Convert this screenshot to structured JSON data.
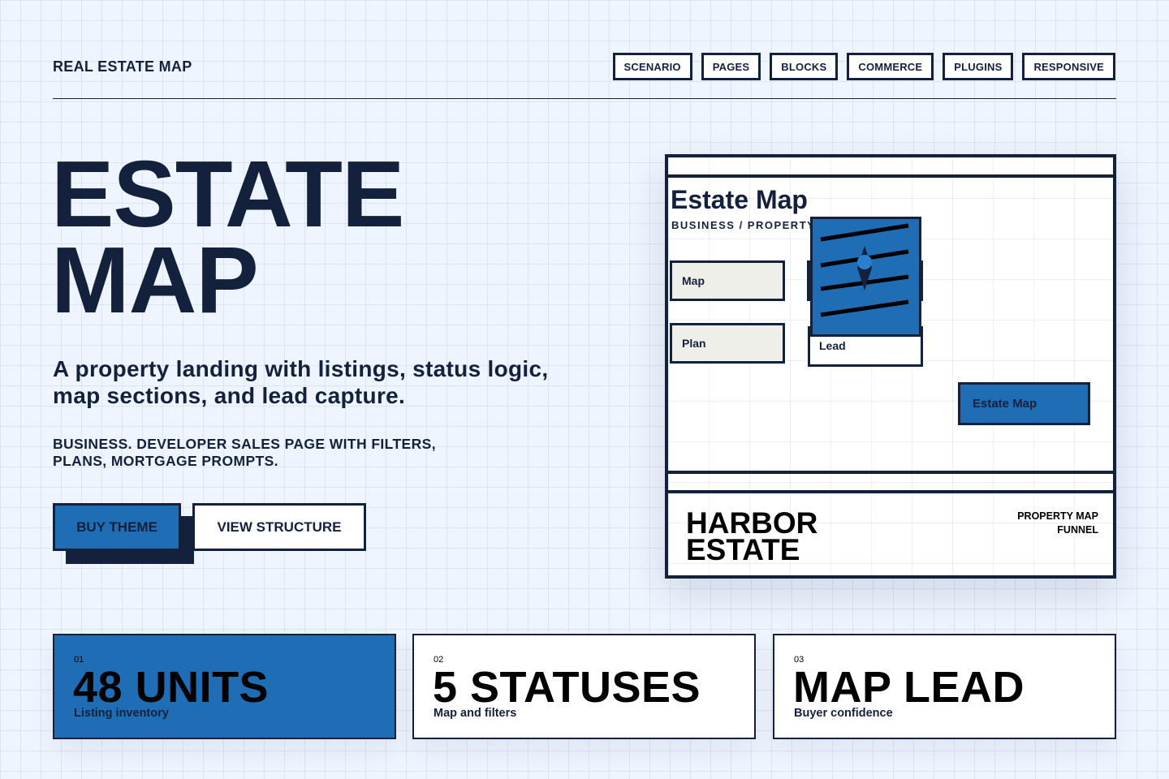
{
  "brand": "REAL ESTATE MAP",
  "nav": [
    "SCENARIO",
    "PAGES",
    "BLOCKS",
    "COMMERCE",
    "PLUGINS",
    "RESPONSIVE"
  ],
  "hero": {
    "title_line1": "ESTATE",
    "title_line2": "MAP",
    "lede": "A property landing with listings, status logic, map sections, and lead capture.",
    "tagline": "BUSINESS. DEVELOPER SALES PAGE WITH FILTERS, PLANS, MORTGAGE PROMPTS.",
    "primary_cta": "BUY THEME",
    "secondary_cta": "VIEW STRUCTURE"
  },
  "preview": {
    "title": "Estate Map",
    "subtitle": "BUSINESS / PROPERTY",
    "chip_map": "Map",
    "chip_plan": "Plan",
    "lead_label": "Lead",
    "estate_button": "Estate Map",
    "footer_title_line1": "HARBOR",
    "footer_title_line2": "ESTATE",
    "footer_meta_line1": "PROPERTY MAP",
    "footer_meta_line2": "FUNNEL",
    "image_icon": "property-image-icon"
  },
  "stats": [
    {
      "num": "01",
      "value": "48 UNITS",
      "label": "Listing inventory"
    },
    {
      "num": "02",
      "value": "5 STATUSES",
      "label": "Map and filters"
    },
    {
      "num": "03",
      "value": "MAP LEAD",
      "label": "Buyer confidence"
    }
  ],
  "colors": {
    "ink": "#14213d",
    "accent_blue": "#1f6db4",
    "page_bg": "#eef5ff",
    "chip_bg": "#efefea",
    "white": "#ffffff"
  }
}
